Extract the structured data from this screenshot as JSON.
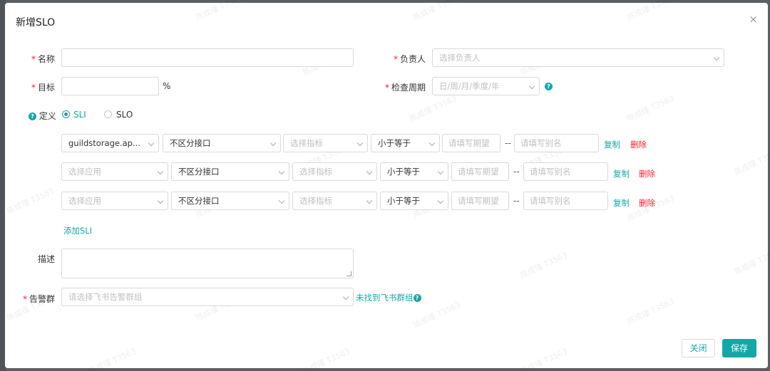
{
  "dialog": {
    "title": "新增SLO",
    "close_glyph": "×"
  },
  "form": {
    "name_label": "名称",
    "owner_label": "负责人",
    "owner_placeholder": "选择负责人",
    "target_label": "目标",
    "target_unit": "%",
    "period_label": "检查周期",
    "period_placeholder": "日/周/月/季度/年",
    "definition_label": "定义",
    "radio_sli": "SLI",
    "radio_slo": "SLO",
    "selected_type": "SLI",
    "desc_label": "描述",
    "alert_label": "告警群",
    "alert_placeholder": "请选择飞书告警群组",
    "alert_link": "未找到飞书群组"
  },
  "sli_rows": [
    {
      "app": "guildstorage.ap...",
      "iface": "不区分接口",
      "metric": "选择指标",
      "op": "小于等于",
      "expect": "请填写期望",
      "sep": "--",
      "alias": "请填写别名",
      "copy": "复制",
      "del": "删除"
    },
    {
      "app": "选择应用",
      "iface": "不区分接口",
      "metric": "选择指标",
      "op": "小于等于",
      "expect": "请填写期望",
      "sep": "--",
      "alias": "请填写别名",
      "copy": "复制",
      "del": "删除"
    },
    {
      "app": "选择应用",
      "iface": "不区分接口",
      "metric": "选择指标",
      "op": "小于等于",
      "expect": "请填写期望",
      "sep": "--",
      "alias": "请填写别名",
      "copy": "复制",
      "del": "删除"
    }
  ],
  "add_sli": "添加SLI",
  "footer": {
    "close": "关闭",
    "save": "保存"
  },
  "watermark": "陈成瑾 T3563",
  "colors": {
    "accent": "#13a8a8",
    "danger": "#f5222d"
  }
}
